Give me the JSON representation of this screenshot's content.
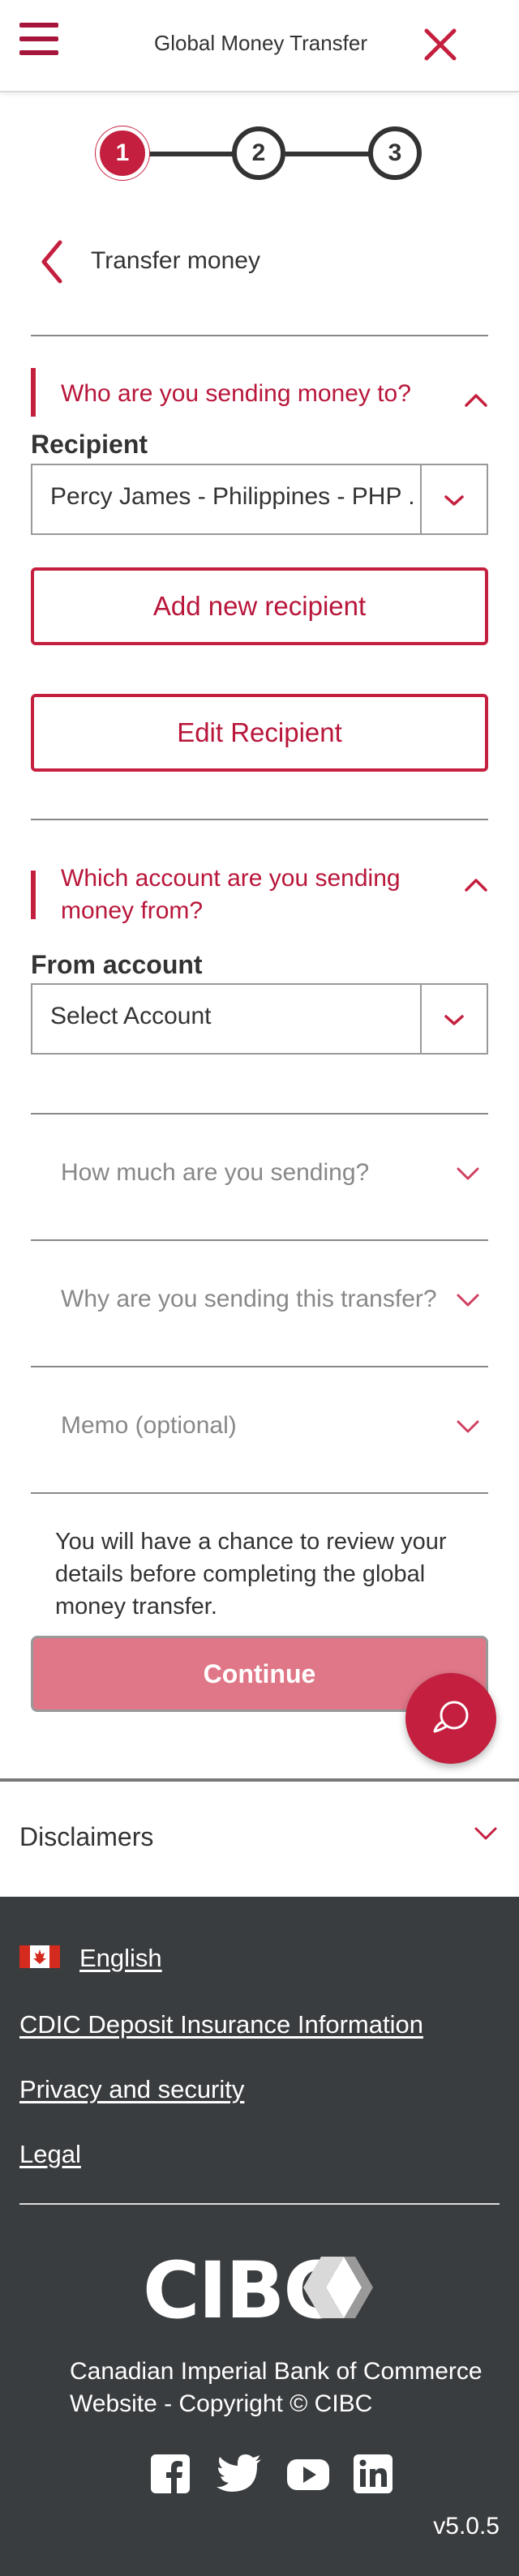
{
  "header": {
    "title": "Global Money Transfer",
    "menu_icon": "hamburger-menu-icon",
    "close_icon": "close-x-icon"
  },
  "steps": [
    "1",
    "2",
    "3"
  ],
  "back": {
    "label": "Transfer money"
  },
  "recipient_section": {
    "title": "Who are you sending money to?",
    "field_label": "Recipient",
    "selected_value": "Percy James - Philippines - PHP ...",
    "add_button": "Add new recipient",
    "edit_button": "Edit Recipient"
  },
  "account_section": {
    "title_line1": "Which account are you sending",
    "title_line2": "money from?",
    "field_label": "From account",
    "selected_value": "Select Account"
  },
  "collapsed_sections": [
    "How much are you sending?",
    "Why are you sending this transfer?",
    "Memo (optional)"
  ],
  "note": "You will have a chance to review your details before completing the global money transfer.",
  "continue_button": "Continue",
  "disclaimers": "Disclaimers",
  "footer": {
    "language": "English",
    "links": [
      "CDIC Deposit Insurance Information",
      "Privacy and security",
      "Legal"
    ],
    "logo": "CIBC",
    "legal_line1": "Canadian Imperial Bank of Commerce",
    "legal_line2": "Website - Copyright © CIBC",
    "social_icons": [
      "facebook-icon",
      "twitter-icon",
      "youtube-icon",
      "linkedin-icon"
    ],
    "version": "v5.0.5"
  },
  "colors": {
    "brand": "#c41f3e",
    "footer_bg": "#3a3d3f",
    "continue_disabled": "#e07788"
  }
}
